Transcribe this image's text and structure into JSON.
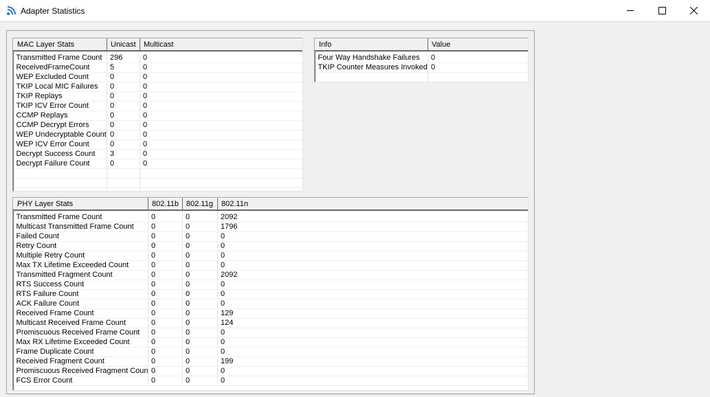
{
  "window": {
    "title": "Adapter Statistics",
    "icon": "wireless-signal-icon",
    "accent_color": "#1e78d8",
    "controls": [
      "minimize-icon",
      "maximize-icon",
      "close-icon"
    ]
  },
  "mac_table": {
    "headers": [
      "MAC Layer Stats",
      "Unicast",
      "Multicast"
    ],
    "rows": [
      [
        "Transmitted Frame Count",
        "296",
        "0"
      ],
      [
        "ReceivedFrameCount",
        "5",
        "0"
      ],
      [
        "WEP Excluded Count",
        "0",
        "0"
      ],
      [
        "TKIP Local MIC Failures",
        "0",
        "0"
      ],
      [
        "TKIP Replays",
        "0",
        "0"
      ],
      [
        "TKIP ICV Error Count",
        "0",
        "0"
      ],
      [
        "CCMP Replays",
        "0",
        "0"
      ],
      [
        "CCMP Decrypt Errors",
        "0",
        "0"
      ],
      [
        "WEP Undecryptable Count",
        "0",
        "0"
      ],
      [
        "WEP ICV Error Count",
        "0",
        "0"
      ],
      [
        "Decrypt Success Count",
        "3",
        "0"
      ],
      [
        "Decrypt Failure Count",
        "0",
        "0"
      ],
      [
        "",
        "",
        ""
      ],
      [
        "",
        "",
        ""
      ],
      [
        "",
        "",
        ""
      ]
    ]
  },
  "info_table": {
    "headers": [
      "Info",
      "Value"
    ],
    "rows": [
      [
        "Four Way Handshake Failures",
        "0"
      ],
      [
        "TKIP Counter Measures Invoked",
        "0"
      ],
      [
        "",
        ""
      ]
    ]
  },
  "phy_table": {
    "headers": [
      "PHY Layer Stats",
      "802.11b",
      "802.11g",
      "802.11n"
    ],
    "rows": [
      [
        "Transmitted Frame Count",
        "0",
        "0",
        "2092"
      ],
      [
        "Multicast Transmitted Frame Count",
        "0",
        "0",
        "1796"
      ],
      [
        "Failed Count",
        "0",
        "0",
        "0"
      ],
      [
        "Retry Count",
        "0",
        "0",
        "0"
      ],
      [
        "Multiple Retry Count",
        "0",
        "0",
        "0"
      ],
      [
        "Max TX Lifetime Exceeded Count",
        "0",
        "0",
        "0"
      ],
      [
        "Transmitted Fragment Count",
        "0",
        "0",
        "2092"
      ],
      [
        "RTS Success Count",
        "0",
        "0",
        "0"
      ],
      [
        "RTS Failure Count",
        "0",
        "0",
        "0"
      ],
      [
        "ACK Failure Count",
        "0",
        "0",
        "0"
      ],
      [
        "Received Frame Count",
        "0",
        "0",
        "129"
      ],
      [
        "Multicast Received Frame Count",
        "0",
        "0",
        "124"
      ],
      [
        "Promiscuous Received Frame Count",
        "0",
        "0",
        "0"
      ],
      [
        "Max RX Lifetime Exceeded Count",
        "0",
        "0",
        "0"
      ],
      [
        "Frame Duplicate Count",
        "0",
        "0",
        "0"
      ],
      [
        "Received Fragment Count",
        "0",
        "0",
        "199"
      ],
      [
        "Promiscuous Received Fragment Count",
        "0",
        "0",
        "0"
      ],
      [
        "FCS Error Count",
        "0",
        "0",
        "0"
      ]
    ]
  }
}
